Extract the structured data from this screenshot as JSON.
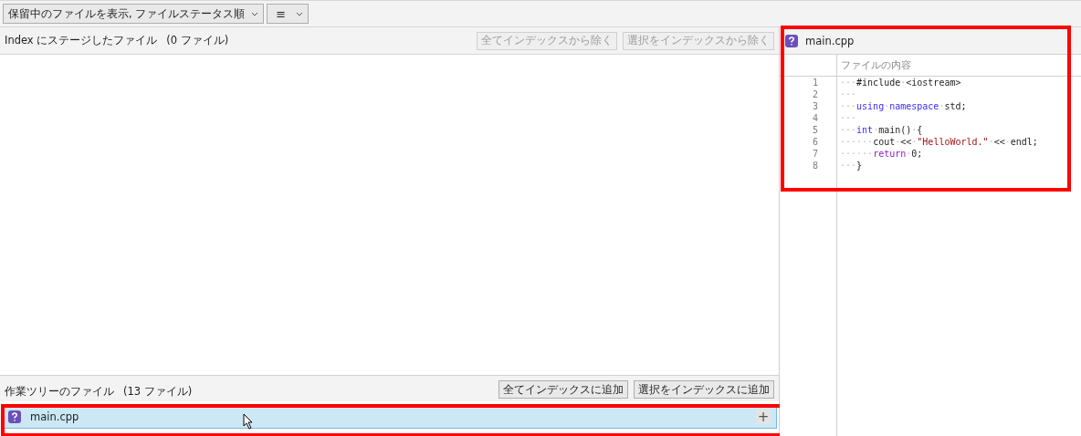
{
  "toolbar": {
    "view_dropdown": "保留中のファイルを表示, ファイルステータス順",
    "menu_button": "≡"
  },
  "staged": {
    "title": "Index にステージしたファイル",
    "count": "(0 ファイル)",
    "buttons": [
      {
        "label": "全てインデックスから除く",
        "disabled": true
      },
      {
        "label": "選択をインデックスから除く",
        "disabled": true
      }
    ]
  },
  "working": {
    "title": "作業ツリーのファイル",
    "count": "(13 ファイル)",
    "buttons": [
      {
        "label": "全てインデックスに追加",
        "disabled": false
      },
      {
        "label": "選択をインデックスに追加",
        "disabled": false
      }
    ],
    "files": [
      {
        "name": "main.cpp",
        "selected": true,
        "action": "+"
      }
    ]
  },
  "preview": {
    "file_name": "main.cpp",
    "column_header": "ファイルの内容",
    "lines": [
      {
        "number": "1",
        "tokens": [
          {
            "kind": "ws",
            "text": "···"
          },
          {
            "kind": "plain",
            "text": "#include"
          },
          {
            "kind": "ws",
            "text": "·"
          },
          {
            "kind": "plain",
            "text": "<iostream>"
          }
        ]
      },
      {
        "number": "2",
        "tokens": [
          {
            "kind": "ws",
            "text": "···"
          }
        ]
      },
      {
        "number": "3",
        "tokens": [
          {
            "kind": "ws",
            "text": "···"
          },
          {
            "kind": "keyword",
            "text": "using"
          },
          {
            "kind": "ws",
            "text": "·"
          },
          {
            "kind": "keyword",
            "text": "namespace"
          },
          {
            "kind": "ws",
            "text": "·"
          },
          {
            "kind": "plain",
            "text": "std;"
          }
        ]
      },
      {
        "number": "4",
        "tokens": [
          {
            "kind": "ws",
            "text": "···"
          }
        ]
      },
      {
        "number": "5",
        "tokens": [
          {
            "kind": "ws",
            "text": "···"
          },
          {
            "kind": "keyword",
            "text": "int"
          },
          {
            "kind": "ws",
            "text": "·"
          },
          {
            "kind": "plain",
            "text": "main()"
          },
          {
            "kind": "ws",
            "text": "·"
          },
          {
            "kind": "plain",
            "text": "{"
          }
        ]
      },
      {
        "number": "6",
        "tokens": [
          {
            "kind": "ws",
            "text": "······"
          },
          {
            "kind": "plain",
            "text": "cout"
          },
          {
            "kind": "ws",
            "text": "·"
          },
          {
            "kind": "plain",
            "text": "<<"
          },
          {
            "kind": "ws",
            "text": "·"
          },
          {
            "kind": "string",
            "text": "\"HelloWorld.\""
          },
          {
            "kind": "ws",
            "text": "·"
          },
          {
            "kind": "plain",
            "text": "<<"
          },
          {
            "kind": "ws",
            "text": "·"
          },
          {
            "kind": "plain",
            "text": "endl;"
          }
        ]
      },
      {
        "number": "7",
        "tokens": [
          {
            "kind": "ws",
            "text": "······"
          },
          {
            "kind": "control",
            "text": "return"
          },
          {
            "kind": "ws",
            "text": "·"
          },
          {
            "kind": "plain",
            "text": "0;"
          }
        ]
      },
      {
        "number": "8",
        "tokens": [
          {
            "kind": "ws",
            "text": "···"
          },
          {
            "kind": "plain",
            "text": "}"
          }
        ]
      }
    ]
  }
}
